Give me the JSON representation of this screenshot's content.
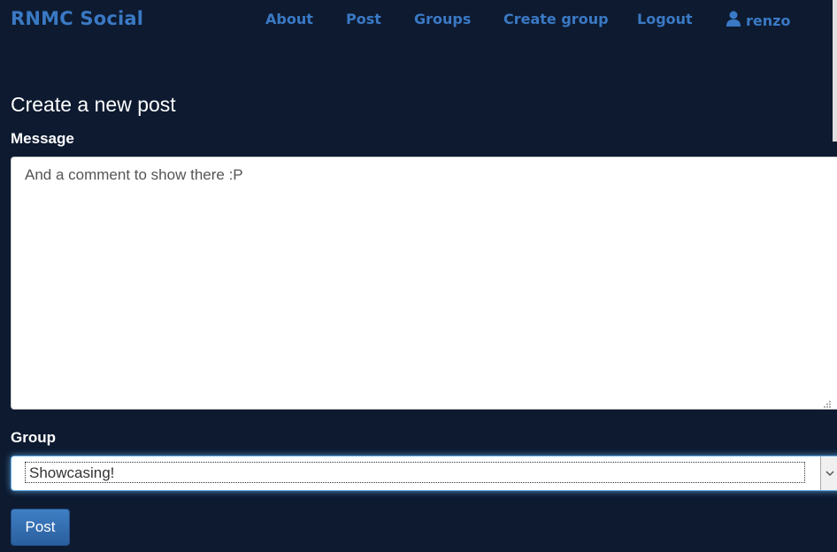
{
  "navbar": {
    "brand": "RNMC Social",
    "links": [
      {
        "label": "About"
      },
      {
        "label": "Post"
      },
      {
        "label": "Groups"
      },
      {
        "label": "Create group"
      },
      {
        "label": "Logout"
      }
    ],
    "user": {
      "label": "renzo",
      "icon": "user-icon"
    }
  },
  "page": {
    "title": "Create a new post"
  },
  "form": {
    "message_label": "Message",
    "message_value": "And a comment to show there :P",
    "group_label": "Group",
    "group_selected": "Showcasing!",
    "submit_label": "Post"
  },
  "colors": {
    "background": "#0d1a30",
    "link": "#3a79c4",
    "button": "#2f6db0"
  }
}
